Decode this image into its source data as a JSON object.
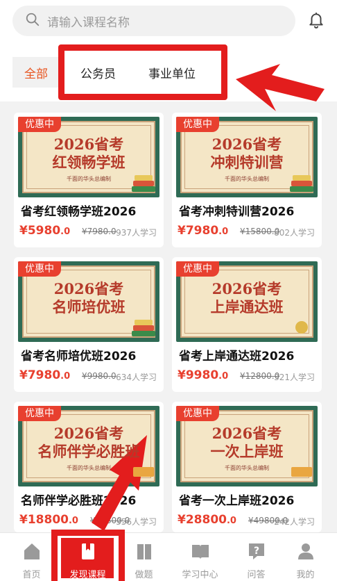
{
  "search": {
    "placeholder": "请输入课程名称",
    "icon": "search-icon"
  },
  "header": {
    "bell_icon": "bell-icon"
  },
  "tabs": [
    {
      "label": "全部",
      "active": true
    },
    {
      "label": "公务员",
      "active": false
    },
    {
      "label": "事业单位",
      "active": false
    }
  ],
  "courses": [
    {
      "badge": "优惠中",
      "thumb_year": "2026省考",
      "thumb_name": "红领畅学班",
      "thumb_sub": "千面的华头总编制",
      "title": "省考红领畅学班2026",
      "price_int": "¥5980",
      "price_dec": ".0",
      "orig_price": "¥7980.0",
      "learners": "937人学习"
    },
    {
      "badge": "优惠中",
      "thumb_year": "2026省考",
      "thumb_name": "冲刺特训营",
      "thumb_sub": "千面的华头总编制",
      "title": "省考冲刺特训营2026",
      "price_int": "¥7980",
      "price_dec": ".0",
      "orig_price": "¥15800.0",
      "learners": "802人学习"
    },
    {
      "badge": "优惠中",
      "thumb_year": "2026省考",
      "thumb_name": "名师培优班",
      "thumb_sub": "",
      "title": "省考名师培优班2026",
      "price_int": "¥7980",
      "price_dec": ".0",
      "orig_price": "¥9980.0",
      "learners": "634人学习"
    },
    {
      "badge": "优惠中",
      "thumb_year": "2026省考",
      "thumb_name": "上岸通达班",
      "thumb_sub": "",
      "title": "省考上岸通达班2026",
      "price_int": "¥9980",
      "price_dec": ".0",
      "orig_price": "¥12800.0",
      "learners": "321人学习"
    },
    {
      "badge": "优惠中",
      "thumb_year": "2026省考",
      "thumb_name": "名师伴学必胜班",
      "thumb_sub": "千面的华头总编制",
      "title": "名师伴学必胜班2026",
      "price_int": "¥18800",
      "price_dec": ".0",
      "orig_price": "¥29800.0",
      "learners": "356人学习"
    },
    {
      "badge": "优惠中",
      "thumb_year": "2026省考",
      "thumb_name": "一次上岸班",
      "thumb_sub": "千面的华头总编制",
      "title": "省考一次上岸班2026",
      "price_int": "¥28800",
      "price_dec": ".0",
      "orig_price": "¥49800.0",
      "learners": "242人学习"
    }
  ],
  "bottom_nav": [
    {
      "label": "首页",
      "icon": "home-icon"
    },
    {
      "label": "发现课程",
      "icon": "bookmark-icon",
      "active": true
    },
    {
      "label": "做题",
      "icon": "books-icon"
    },
    {
      "label": "学习中心",
      "icon": "open-book-icon"
    },
    {
      "label": "问答",
      "icon": "question-icon"
    },
    {
      "label": "我的",
      "icon": "user-icon"
    }
  ],
  "colors": {
    "accent": "#e8402f",
    "annotation_red": "#e31d1d",
    "thumb_green": "#2f6b55"
  }
}
